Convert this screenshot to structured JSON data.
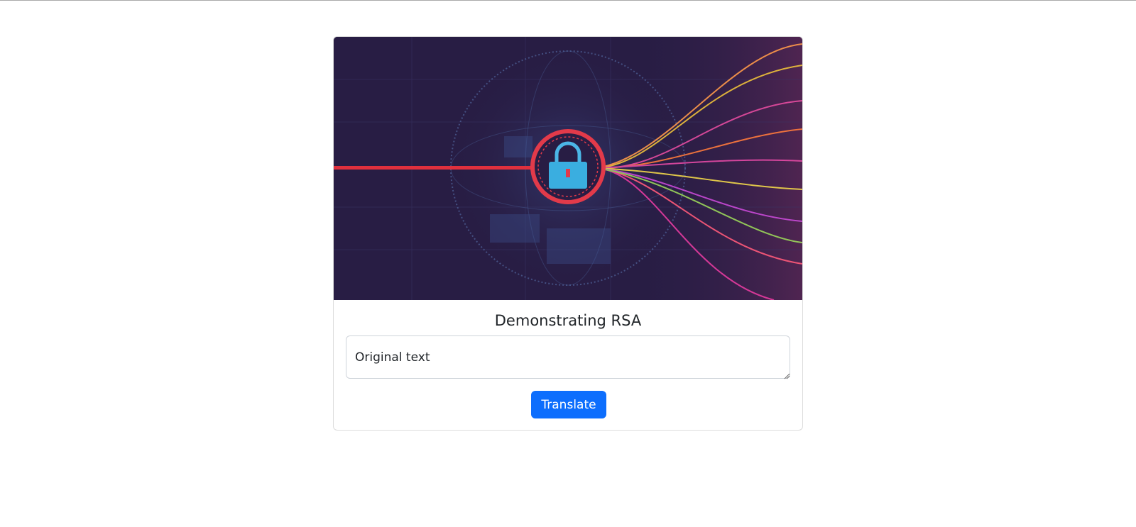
{
  "card": {
    "hero_image": {
      "icon": "padlock-icon",
      "colors": {
        "background": "#2a1f49",
        "laser": "#e0303d",
        "ring": "#e23a4a",
        "lock": "#3aaee0"
      }
    },
    "title": "Demonstrating RSA",
    "input": {
      "value": "Original text",
      "placeholder": "Original text"
    },
    "translate_label": "Translate"
  },
  "colors": {
    "primary": "#0d6efd",
    "border": "#dcdcdc"
  }
}
